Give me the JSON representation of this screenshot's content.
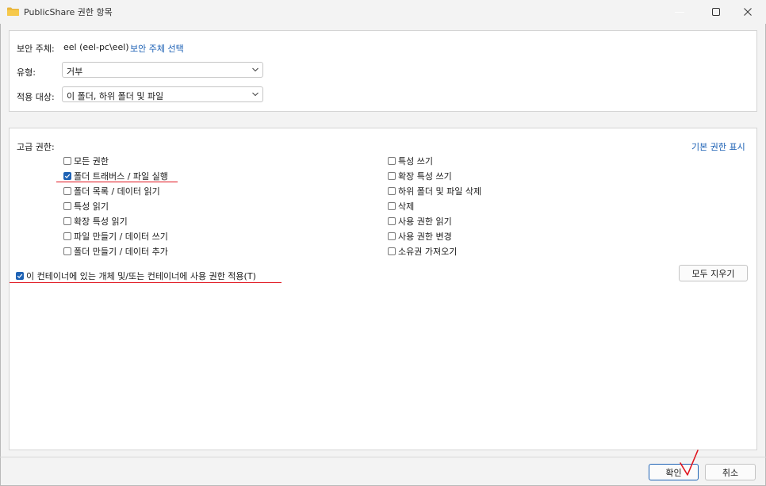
{
  "window": {
    "title": "PublicShare 권한 항목",
    "icon": "folder-icon",
    "controls": {
      "minimize": "—",
      "maximize": "☐",
      "close": "✕"
    }
  },
  "principal": {
    "label": "보안 주체:",
    "value": "eel (eel-pc\\eel)",
    "select_link": "보안 주체 선택"
  },
  "type": {
    "label": "유형:",
    "value": "거부"
  },
  "applies_to": {
    "label": "적용 대상:",
    "value": "이 폴더, 하위 폴더 및 파일"
  },
  "advanced": {
    "label": "고급 권한:",
    "show_basic_link": "기본 권한 표시",
    "left_permissions": [
      {
        "label": "모든 권한",
        "checked": false
      },
      {
        "label": "폴더 트래버스 / 파일 실행",
        "checked": true
      },
      {
        "label": "폴더 목록 / 데이터 읽기",
        "checked": false
      },
      {
        "label": "특성 읽기",
        "checked": false
      },
      {
        "label": "확장 특성 읽기",
        "checked": false
      },
      {
        "label": "파일 만들기 / 데이터 쓰기",
        "checked": false
      },
      {
        "label": "폴더 만들기 / 데이터 추가",
        "checked": false
      }
    ],
    "right_permissions": [
      {
        "label": "특성 쓰기",
        "checked": false
      },
      {
        "label": "확장 특성 쓰기",
        "checked": false
      },
      {
        "label": "하위 폴더 및 파일 삭제",
        "checked": false
      },
      {
        "label": "삭제",
        "checked": false
      },
      {
        "label": "사용 권한 읽기",
        "checked": false
      },
      {
        "label": "사용 권한 변경",
        "checked": false
      },
      {
        "label": "소유권 가져오기",
        "checked": false
      }
    ]
  },
  "apply_container": {
    "label": "이 컨테이너에 있는 개체 및/또는 컨테이너에 사용 권한 적용(T)",
    "checked": true
  },
  "buttons": {
    "clear_all": "모두 지우기",
    "ok": "확인",
    "cancel": "취소"
  },
  "annotation_color": "#e0141e",
  "accent_color": "#1f63b5"
}
